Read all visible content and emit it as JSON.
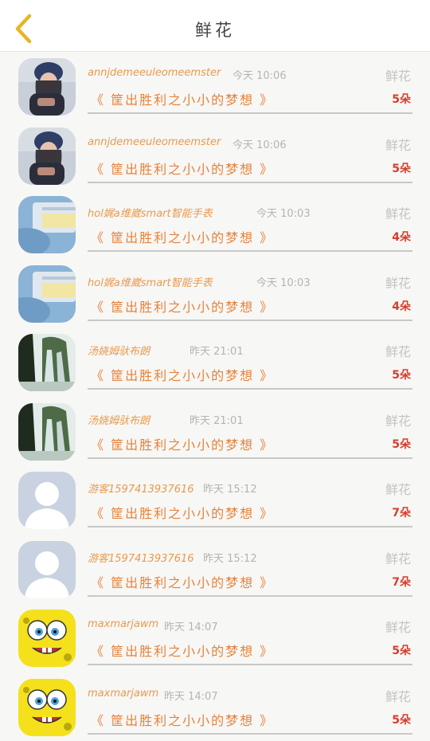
{
  "header": {
    "title": "鲜花",
    "back_icon": "chevron-left-icon",
    "accent": "#e8b526"
  },
  "rows": [
    {
      "name": "annjdemeeuleomeemster",
      "time": "今天  10:06",
      "label": "鲜花",
      "message": "《 筐出胜利之小小的梦想 》",
      "count": "5朵",
      "avatar": "avatar-girl"
    },
    {
      "name": "annjdemeeuleomeemster",
      "time": "今天  10:06",
      "label": "鲜花",
      "message": "《 筐出胜利之小小的梦想 》",
      "count": "5朵",
      "avatar": "avatar-girl"
    },
    {
      "name": "hol娓a维崴smart智能手表",
      "time": "今天  10:03",
      "label": "鲜花",
      "message": "《 筐出胜利之小小的梦想 》",
      "count": "4朵",
      "avatar": "avatar-blue"
    },
    {
      "name": "hol娓a维崴smart智能手表",
      "time": "今天  10:03",
      "label": "鲜花",
      "message": "《 筐出胜利之小小的梦想 》",
      "count": "4朵",
      "avatar": "avatar-blue"
    },
    {
      "name": "汤娆姆驮布朗",
      "time": "昨天  21:01",
      "label": "鲜花",
      "message": "《 筐出胜利之小小的梦想 》",
      "count": "5朵",
      "avatar": "avatar-waterfall"
    },
    {
      "name": "汤娆姆驮布朗",
      "time": "昨天  21:01",
      "label": "鲜花",
      "message": "《 筐出胜利之小小的梦想 》",
      "count": "5朵",
      "avatar": "avatar-waterfall"
    },
    {
      "name": "游客1597413937616",
      "time": "昨天  15:12",
      "label": "鲜花",
      "message": "《 筐出胜利之小小的梦想 》",
      "count": "7朵",
      "avatar": "avatar-default"
    },
    {
      "name": "游客1597413937616",
      "time": "昨天  15:12",
      "label": "鲜花",
      "message": "《 筐出胜利之小小的梦想 》",
      "count": "7朵",
      "avatar": "avatar-default"
    },
    {
      "name": "maxmarjawm",
      "time": "昨天  14:07",
      "label": "鲜花",
      "message": "《 筐出胜利之小小的梦想 》",
      "count": "5朵",
      "avatar": "avatar-sponge"
    },
    {
      "name": "maxmarjawm",
      "time": "昨天  14:07",
      "label": "鲜花",
      "message": "《 筐出胜利之小小的梦想 》",
      "count": "5朵",
      "avatar": "avatar-sponge"
    }
  ]
}
